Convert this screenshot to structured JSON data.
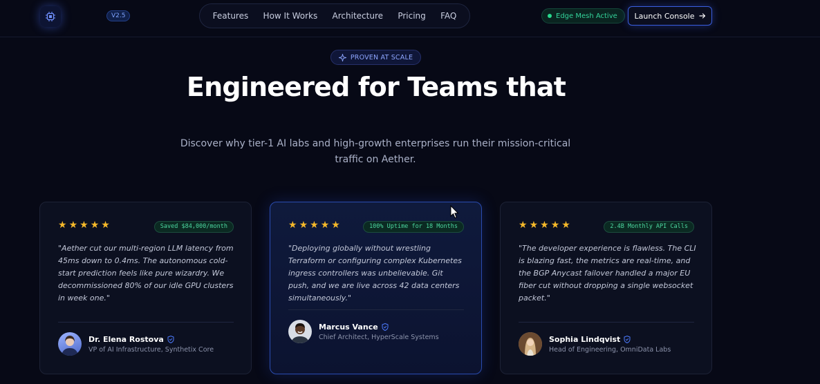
{
  "nav": {
    "version": "V2.5",
    "menu": [
      "Features",
      "How It Works",
      "Architecture",
      "Pricing",
      "FAQ"
    ],
    "status": "Edge Mesh Active",
    "launch": "Launch Console"
  },
  "hero": {
    "pill": "PROVEN AT SCALE",
    "title": "Engineered for Teams that",
    "subtitle": "Discover why tier-1 AI labs and high-growth enterprises run their mission-critical traffic on Aether."
  },
  "testimonials": [
    {
      "rating": 5,
      "badge": "Saved $84,000/month",
      "quote": "\"Aether cut our multi-region LLM latency from 45ms down to 0.4ms. The autonomous cold-start prediction feels like pure wizardry. We decommissioned 80% of our idle GPU clusters in week one.\"",
      "name": "Dr. Elena Rostova",
      "role": "VP of AI Infrastructure, Synthetix Core"
    },
    {
      "rating": 5,
      "badge": "100% Uptime for 18 Months",
      "quote": "\"Deploying globally without wrestling Terraform or configuring complex Kubernetes ingress controllers was unbelievable. Git push, and we are live across 42 data centers simultaneously.\"",
      "name": "Marcus Vance",
      "role": "Chief Architect, HyperScale Systems"
    },
    {
      "rating": 5,
      "badge": "2.4B Monthly API Calls",
      "quote": "\"The developer experience is flawless. The CLI is blazing fast, the metrics are real-time, and the BGP Anycast failover handled a major EU fiber cut without dropping a single websocket packet.\"",
      "name": "Sophia Lindqvist",
      "role": "Head of Engineering, OmniData Labs"
    }
  ],
  "colors": {
    "background": "#070916",
    "accent": "#3a5fe0",
    "star": "#f5b82a",
    "success": "#33d39a"
  }
}
